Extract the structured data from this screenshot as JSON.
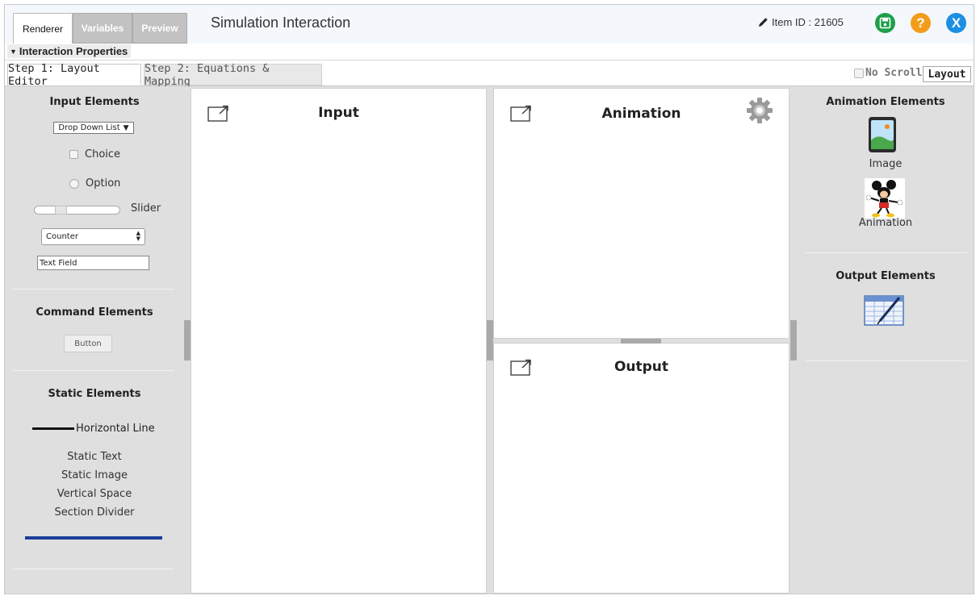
{
  "header": {
    "tabs": [
      "Renderer",
      "Variables",
      "Preview"
    ],
    "title": "Simulation Interaction",
    "item_id": "Item ID : 21605",
    "help_label": "?",
    "close_label": "X"
  },
  "properties_bar": {
    "label": "Interaction Properties"
  },
  "steps": {
    "tabs": [
      "Step 1: Layout Editor",
      "Step 2: Equations & Mapping"
    ],
    "no_scroll_label": "No Scroll",
    "layout_button": "Layout"
  },
  "left_panel": {
    "input_heading": "Input Elements",
    "dropdown_label": "Drop Down List",
    "choice_label": "Choice",
    "option_label": "Option",
    "slider_label": "Slider",
    "counter_label": "Counter",
    "text_field_label": "Text Field",
    "command_heading": "Command Elements",
    "button_label": "Button",
    "static_heading": "Static Elements",
    "horizontal_line_label": "Horizontal Line",
    "static_items": [
      "Static Text",
      "Static Image",
      "Vertical Space",
      "Section Divider"
    ]
  },
  "panes": {
    "input": "Input",
    "animation": "Animation",
    "output": "Output"
  },
  "right_panel": {
    "animation_heading": "Animation Elements",
    "image_label": "Image",
    "animation_label": "Animation",
    "output_heading": "Output Elements"
  },
  "colors": {
    "save": "#1e9e4a",
    "help": "#f39c1a",
    "close": "#1d8fe3",
    "section_divider": "#1a3d97"
  }
}
